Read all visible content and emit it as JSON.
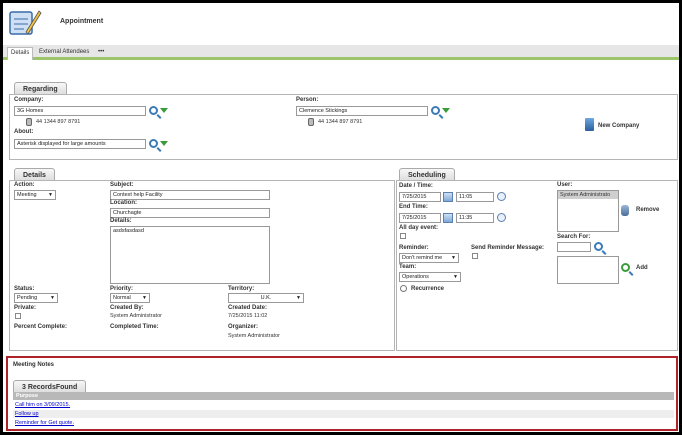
{
  "header": {
    "title": "Appointment"
  },
  "tabs": [
    {
      "label": "Details",
      "active": true
    },
    {
      "label": "External Attendees",
      "active": false
    },
    {
      "label": "•••",
      "active": false
    }
  ],
  "regarding": {
    "tab_label": "Regarding",
    "company_label": "Company:",
    "company_value": "3G Homes",
    "company_phone": "44 1344 897 8791",
    "about_label": "About:",
    "about_value": "Asterisk displayed for large amounts",
    "person_label": "Person:",
    "person_value": "Clemence Stickings",
    "person_phone": "44 1344 897 8791",
    "new_company_label": "New Company"
  },
  "details": {
    "tab_label": "Details",
    "action_label": "Action:",
    "action_value": "Meeting",
    "subject_label": "Subject:",
    "subject_value": "Context help Facility",
    "location_label": "Location:",
    "location_value": "Churchagte",
    "details_label": "Details:",
    "details_value": "asdsfasdasd",
    "status_label": "Status:",
    "status_value": "Pending",
    "priority_label": "Priority:",
    "priority_value": "Normal",
    "territory_label": "Territory:",
    "territory_value": "U.K.",
    "private_label": "Private:",
    "created_by_label": "Created By:",
    "created_by_value": "System Administrator",
    "created_date_label": "Created Date:",
    "created_date_value": "7/25/2015 11:02",
    "percent_complete_label": "Percent Complete:",
    "completed_time_label": "Completed Time:",
    "organizer_label": "Organizer:",
    "organizer_value": "System Administrator"
  },
  "scheduling": {
    "tab_label": "Scheduling",
    "date_time_label": "Date / Time:",
    "start_date": "7/25/2015",
    "start_time": "11:05",
    "end_time_label": "End Time:",
    "end_date": "7/25/2015",
    "end_time": "11:35",
    "all_day_label": "All day event:",
    "reminder_label": "Reminder:",
    "reminder_value": "Don't remind me",
    "send_reminder_label": "Send Reminder Message:",
    "team_label": "Team:",
    "team_value": "Operations",
    "recurrence_label": "Recurrence",
    "user_label": "User:",
    "user_item": "System Administrato",
    "remove_label": "Remove",
    "search_for_label": "Search For:",
    "add_label": "Add"
  },
  "meeting_notes": {
    "title": "Meeting Notes",
    "tab_label": "3 RecordsFound",
    "column_header": "Purpose",
    "rows": [
      "Call him on 3/09/2015.",
      "Follow up",
      "Reminder for Get quote."
    ]
  },
  "colors": {
    "accent_green": "#9cc56a",
    "highlight_red": "#b0222a",
    "link_blue": "#0000cc"
  }
}
